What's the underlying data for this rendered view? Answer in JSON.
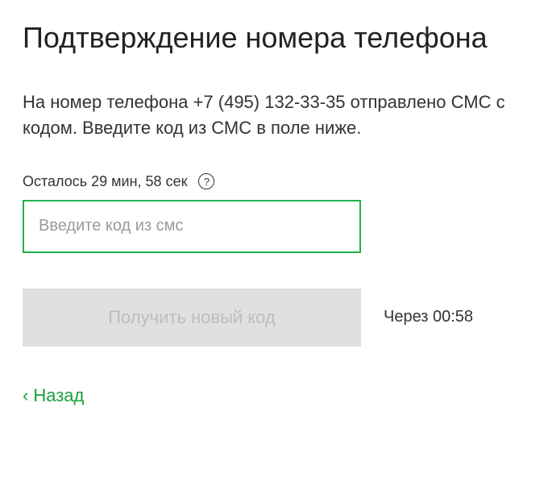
{
  "title": "Подтверждение номера телефона",
  "description": "На номер телефона +7 (495) 132-33-35 отправлено СМС с кодом. Введите код из СМС в поле ниже.",
  "timer": {
    "label": "Осталось 29 мин, 58 сек"
  },
  "input": {
    "placeholder": "Введите код из смс",
    "value": ""
  },
  "resend": {
    "button_label": "Получить новый код",
    "cooldown_label": "Через 00:58"
  },
  "back": {
    "label": "Назад"
  }
}
